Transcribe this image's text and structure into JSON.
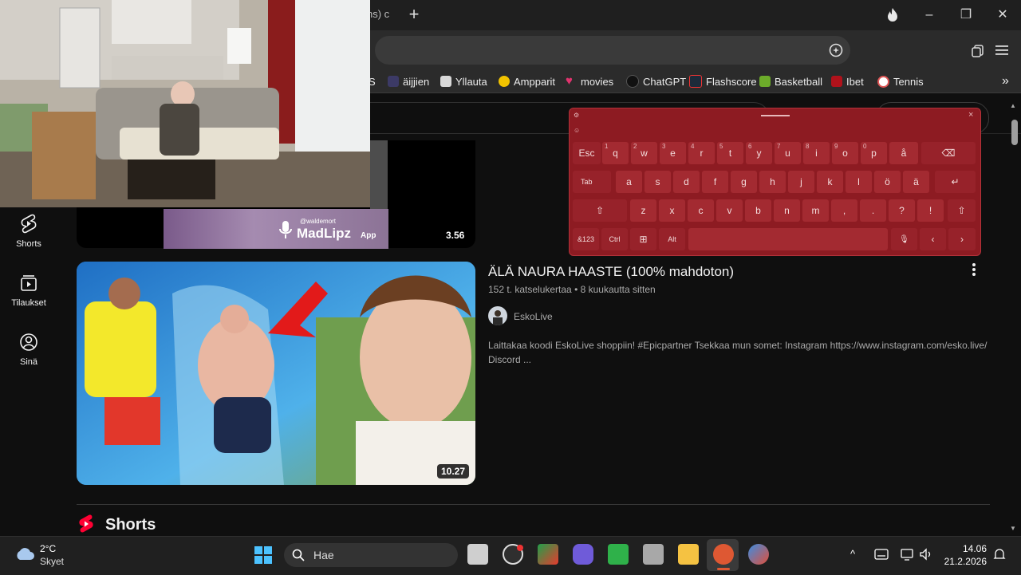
{
  "browser": {
    "tab_fragment": "ns) c",
    "new_tab": "+",
    "window_controls": [
      "–",
      "❐",
      "✕"
    ],
    "bookmarks": [
      {
        "label": "S",
        "icon": "bookmark-icon",
        "color": "#ffffff"
      },
      {
        "label": "äijjien",
        "icon": "dancer-icon",
        "color": "#6a5acd"
      },
      {
        "label": "Yllauta",
        "icon": "ylilauta-icon",
        "color": "#dddddd"
      },
      {
        "label": "Ampparit",
        "icon": "ampparit-hex-icon",
        "color": "#f2c300"
      },
      {
        "label": "movies",
        "icon": "heart-icon",
        "color": "#e0336e"
      },
      {
        "label": "ChatGPT",
        "icon": "chatgpt-icon",
        "color": "#222222"
      },
      {
        "label": "Flashscore",
        "icon": "flashscore-icon",
        "color": "#1c2b3a"
      },
      {
        "label": "Basketball",
        "icon": "basketball-figure-icon",
        "color": "#6cab2a"
      },
      {
        "label": "Ibet",
        "icon": "ibet-icon",
        "color": "#b0121b"
      },
      {
        "label": "Tennis",
        "icon": "tennis-icon",
        "color": "#ffffff"
      }
    ],
    "bookmarks_more": "»"
  },
  "youtube": {
    "sidebar": [
      {
        "label": "Shorts",
        "icon": "shorts-icon"
      },
      {
        "label": "Tilaukset",
        "icon": "subscriptions-icon"
      },
      {
        "label": "Sinä",
        "icon": "you-icon"
      }
    ],
    "prev_video": {
      "duration": "3.56",
      "watermark": "MadLipz",
      "watermark_app": "App",
      "watermark_handle": "@waldemort"
    },
    "video": {
      "title": "ÄLÄ NAURA HAASTE (100% mahdoton)",
      "views": "152 t. katselukertaa",
      "age": "8 kuukautta sitten",
      "channel": "EskoLive",
      "description": "Laittakaa koodi EskoLive shoppiin! #Epicpartner Tsekkaa mun somet: Instagram https://www.instagram.com/esko.live/ Discord ...",
      "duration": "10.27"
    },
    "shorts_heading": "Shorts"
  },
  "keyboard": {
    "close": "×",
    "row1": [
      {
        "k": "Esc",
        "n": ""
      },
      {
        "k": "q",
        "n": "1"
      },
      {
        "k": "w",
        "n": "2"
      },
      {
        "k": "e",
        "n": "3"
      },
      {
        "k": "r",
        "n": "4"
      },
      {
        "k": "t",
        "n": "5"
      },
      {
        "k": "y",
        "n": "6"
      },
      {
        "k": "u",
        "n": "7"
      },
      {
        "k": "i",
        "n": "8"
      },
      {
        "k": "o",
        "n": "9"
      },
      {
        "k": "p",
        "n": "0"
      },
      {
        "k": "å",
        "n": ""
      }
    ],
    "row2": [
      "Tab",
      "a",
      "s",
      "d",
      "f",
      "g",
      "h",
      "j",
      "k",
      "l",
      "ö",
      "ä"
    ],
    "row3": [
      "z",
      "x",
      "c",
      "v",
      "b",
      "n",
      "m",
      ",",
      ".",
      "?",
      "!"
    ],
    "row4": [
      "&123",
      "Ctrl",
      "⊞",
      "Alt"
    ],
    "backspace": "⌫",
    "enter": "↵",
    "shift": "⇧",
    "mic": "🎙",
    "left": "‹",
    "right": "›"
  },
  "taskbar": {
    "weather_temp": "2°C",
    "weather_text": "Skyet",
    "search_placeholder": "Hae",
    "time": "14.06",
    "date": "21.2.2026",
    "tray_up": "^"
  }
}
